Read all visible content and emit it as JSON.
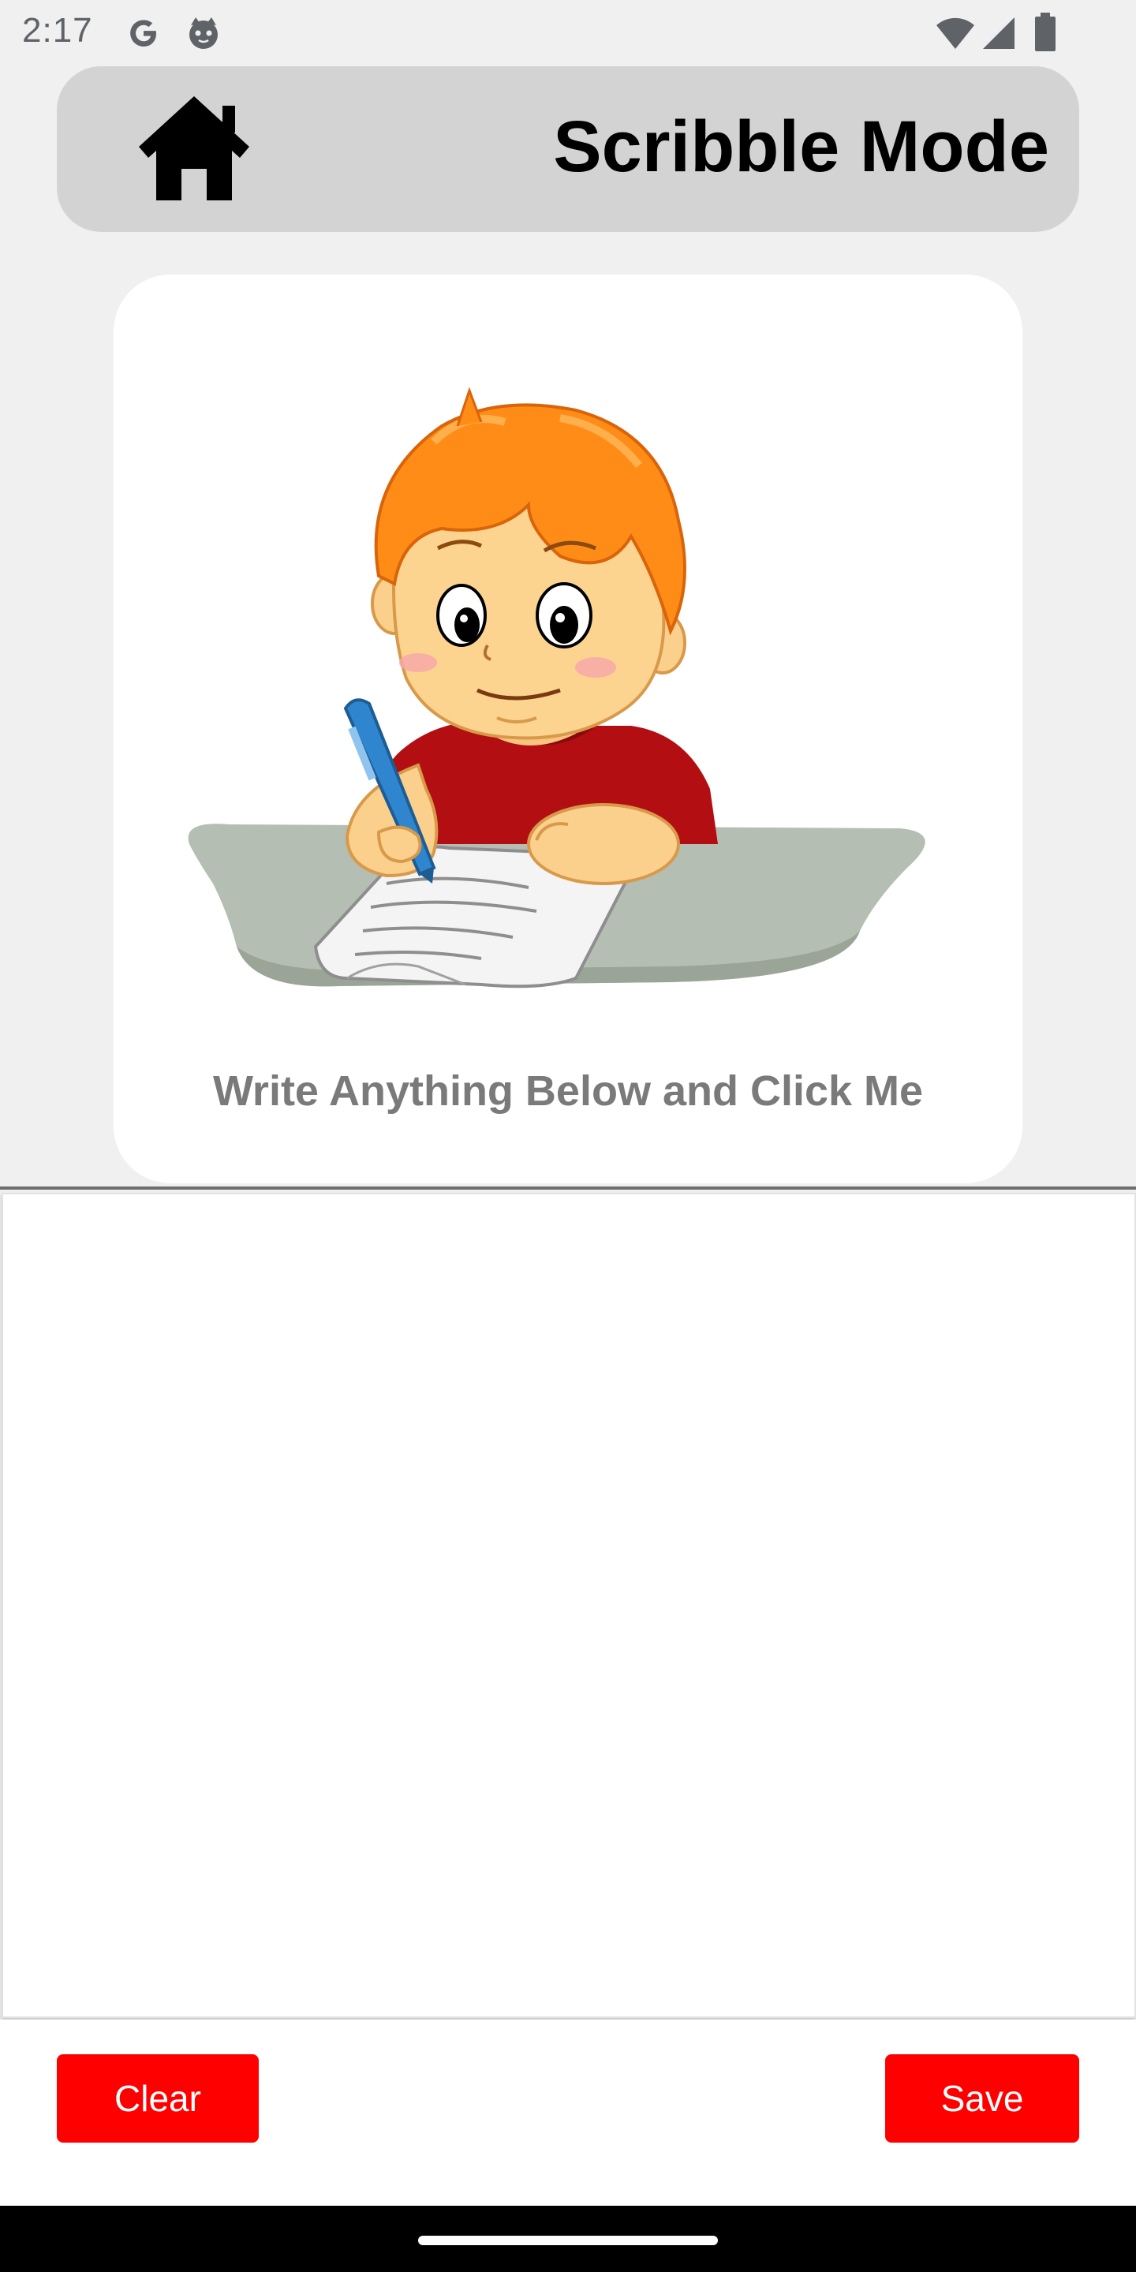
{
  "status_bar": {
    "time": "2:17",
    "left_icons": [
      "google-g-icon",
      "cat-face-icon"
    ],
    "right_icons": [
      "wifi-icon",
      "cellular-signal-icon",
      "battery-icon"
    ]
  },
  "header": {
    "title": "Scribble Mode",
    "home_icon": "home-icon",
    "background_color": "#d3d3d3"
  },
  "prompt_card": {
    "illustration": "child-writing-with-pen-illustration",
    "text": "Write Anything Below and Click Me"
  },
  "drawing_canvas": {
    "background_color": "#ffffff"
  },
  "actions": {
    "clear_label": "Clear",
    "save_label": "Save",
    "button_color": "#ff0000"
  },
  "nav_bar": {
    "handle": "gesture-home-handle"
  }
}
